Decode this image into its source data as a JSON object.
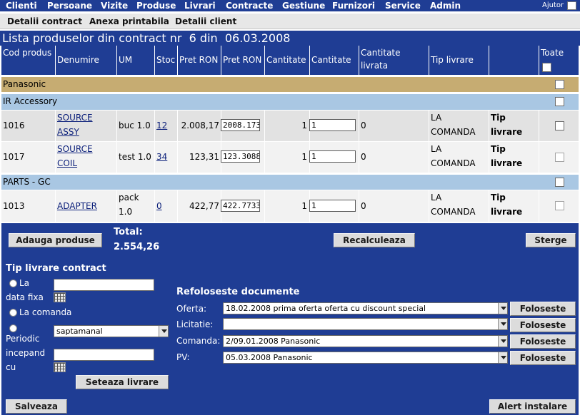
{
  "top_menu": {
    "items": [
      "Clienti",
      "Persoane",
      "Vizite",
      "Produse",
      "Livrari",
      "Contracte",
      "Gestiune",
      "Furnizori",
      "Service",
      "Admin"
    ],
    "help_label": "Ajutor"
  },
  "sub_menu": {
    "items": [
      "Detalii contract",
      "Anexa printabila",
      "Detalii client"
    ]
  },
  "page_title": "Lista produselor din contract nr  6 din  06.03.2008",
  "table": {
    "headers": {
      "cod": "Cod produs",
      "denumire": "Denumire",
      "um": "UM",
      "stoc": "Stoc",
      "pret1": "Pret RON",
      "pret2": "Pret RON",
      "cant1": "Cantitate",
      "cant2": "Cantitate",
      "livrata": "Cantitate livrata",
      "tip": "Tip livrare",
      "toate": "Toate"
    },
    "groups": {
      "g1": "Panasonic",
      "g2": "IR Accessory",
      "g3": "PARTS - GC"
    },
    "rows": [
      {
        "cod": "1016",
        "den1": "SOURCE",
        "den2": "ASSY",
        "um1": "buc 1.0",
        "um2": "",
        "stoc": "12",
        "pret": "2.008,17",
        "pret_input": "2008.173",
        "cant": "1",
        "cant_input": "1",
        "livrata": "0",
        "tip1": "LA",
        "tip2": "COMANDA",
        "tiplink1": "Tip",
        "tiplink2": "livrare"
      },
      {
        "cod": "1017",
        "den1": "SOURCE",
        "den2": "COIL",
        "um1": "test 1.0",
        "um2": "",
        "stoc": "34",
        "pret": "123,31",
        "pret_input": "123.3088",
        "cant": "1",
        "cant_input": "1",
        "livrata": "0",
        "tip1": "LA",
        "tip2": "COMANDA",
        "tiplink1": "Tip",
        "tiplink2": "livrare"
      },
      {
        "cod": "1013",
        "den1": "ADAPTER",
        "den2": "",
        "um1": "pack",
        "um2": "1.0",
        "stoc": "0",
        "pret": "422,77",
        "pret_input": "422.7733",
        "cant": "1",
        "cant_input": "1",
        "livrata": "0",
        "tip1": "LA",
        "tip2": "COMANDA",
        "tiplink1": "Tip",
        "tiplink2": "livrare"
      }
    ]
  },
  "actions": {
    "add_products": "Adauga produse",
    "total_label": "Total:",
    "total_value": "2.554,26",
    "recalculate": "Recalculeaza",
    "delete": "Sterge",
    "save": "Salveaza",
    "install_alert": "Alert instalare"
  },
  "delivery": {
    "heading": "Tip livrare contract",
    "fixed_date_l1": "La",
    "fixed_date_l2": "data fixa",
    "on_order": "La comanda",
    "periodic_l1": "Periodic",
    "periodic_l2": "incepand",
    "periodic_l3": "cu",
    "period_value": "saptamanal",
    "set_button": "Seteaza livrare"
  },
  "reuse": {
    "heading": "Refoloseste documente",
    "offer_label": "Oferta:",
    "offer_value": "18.02.2008 prima oferta oferta cu discount special",
    "tender_label": "Licitatie:",
    "tender_value": "",
    "order_label": "Comanda:",
    "order_value": "2/09.01.2008 Panasonic",
    "pv_label": "PV:",
    "pv_value": "05.03.2008 Panasonic",
    "use_button": "Foloseste"
  }
}
